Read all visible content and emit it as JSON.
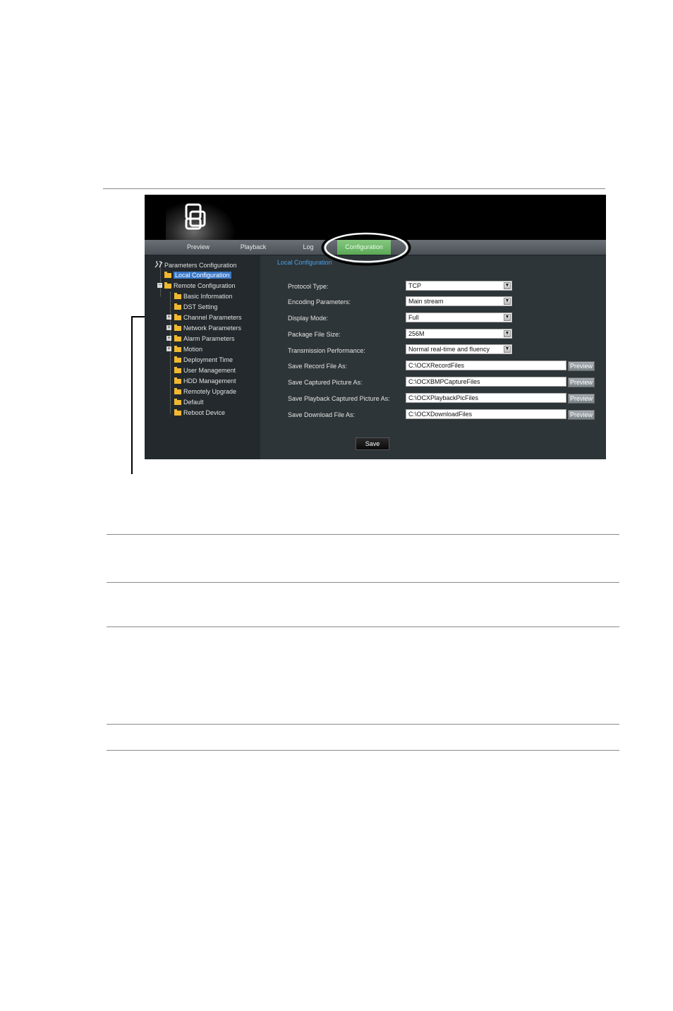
{
  "nav": {
    "preview": "Preview",
    "playback": "Playback",
    "log": "Log",
    "configuration": "Configuration"
  },
  "tree": {
    "root": "Parameters Configuration",
    "local_configuration": "Local Configuration",
    "remote_configuration": "Remote Configuration",
    "basic_information": "Basic Information",
    "dst_setting": "DST Setting",
    "channel_parameters": "Channel Parameters",
    "network_parameters": "Network Parameters",
    "alarm_parameters": "Alarm Parameters",
    "motion": "Motion",
    "deployment_time": "Deployment Time",
    "user_management": "User Management",
    "hdd_management": "HDD Management",
    "remotely_upgrade": "Remotely Upgrade",
    "default": "Default",
    "reboot_device": "Reboot Device"
  },
  "form": {
    "title": "Local Configuration",
    "protocol_type": {
      "label": "Protocol Type:",
      "value": "TCP"
    },
    "encoding_parameters": {
      "label": "Encoding Parameters:",
      "value": "Main stream"
    },
    "display_mode": {
      "label": "Display Mode:",
      "value": "Full"
    },
    "package_file_size": {
      "label": "Package File Size:",
      "value": "256M"
    },
    "transmission_performance": {
      "label": "Transmission Performance:",
      "value": "Normal real-time and fluency"
    },
    "save_record_file": {
      "label": "Save Record File As:",
      "value": "C:\\OCXRecordFiles"
    },
    "save_captured_picture": {
      "label": "Save Captured Picture As:",
      "value": "C:\\OCXBMPCaptureFiles"
    },
    "save_playback_captured_picture": {
      "label": "Save Playback Captured Picture As:",
      "value": "C:\\OCXPlaybackPicFiles"
    },
    "save_download_file": {
      "label": "Save Download File As:",
      "value": "C:\\OCXDownloadFiles"
    },
    "preview_label": "Preview",
    "save_label": "Save"
  },
  "colors": {
    "app_background": "#2e3538",
    "sidebar_background": "#23292c",
    "active_tab": "#6cba68",
    "selected_item": "#3a78c8",
    "section_title": "#4aa0e8"
  },
  "icons": [
    "logo-icon",
    "folder-icon",
    "expand-icon",
    "collapse-icon",
    "dropdown-arrow-icon",
    "tools-icon"
  ]
}
